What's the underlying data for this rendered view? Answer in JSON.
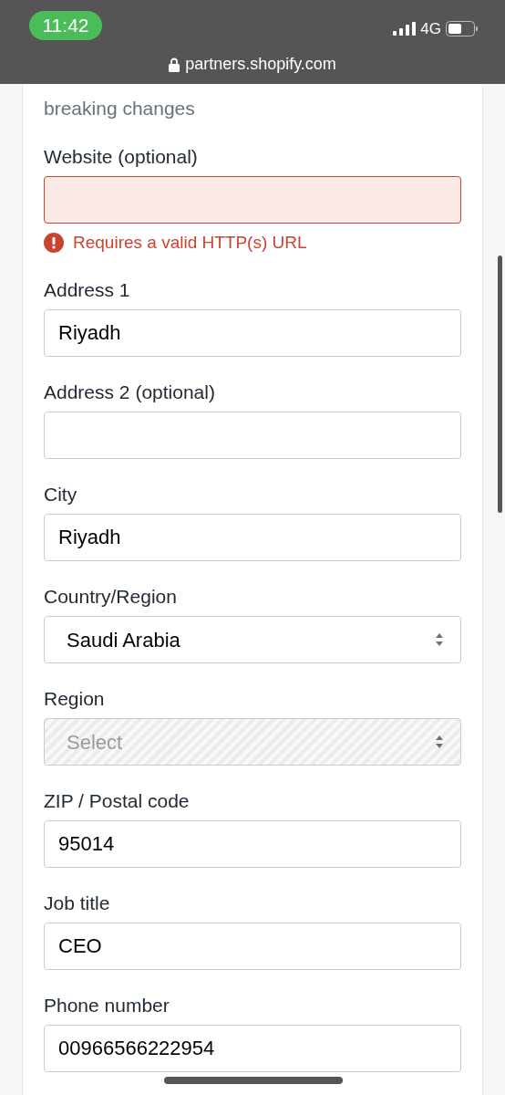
{
  "status_bar": {
    "time": "11:42",
    "network": "4G"
  },
  "address_bar": {
    "url": "partners.shopify.com"
  },
  "description": "breaking changes",
  "fields": [
    {
      "kind": "text",
      "label": "Website (optional)",
      "error": "Requires a valid HTTP(s) URL",
      "disabled": false
    },
    {
      "kind": "text",
      "label": "Address 1",
      "value": "Riyadh",
      "disabled": false
    },
    {
      "kind": "text",
      "label": "Address 2 (optional)",
      "disabled": false
    },
    {
      "kind": "text",
      "label": "City",
      "value": "Riyadh",
      "disabled": false
    },
    {
      "kind": "select",
      "label": "Country/Region",
      "value": "Saudi Arabia",
      "disabled": false
    },
    {
      "kind": "select",
      "label": "Region",
      "placeholder": "Select",
      "disabled": true
    },
    {
      "kind": "text",
      "label": "ZIP / Postal code",
      "value": "95014",
      "disabled": false
    },
    {
      "kind": "text",
      "label": "Job title",
      "value": "CEO",
      "disabled": false
    },
    {
      "kind": "text",
      "label": "Phone number",
      "value": "00966566222954",
      "disabled": false
    }
  ]
}
